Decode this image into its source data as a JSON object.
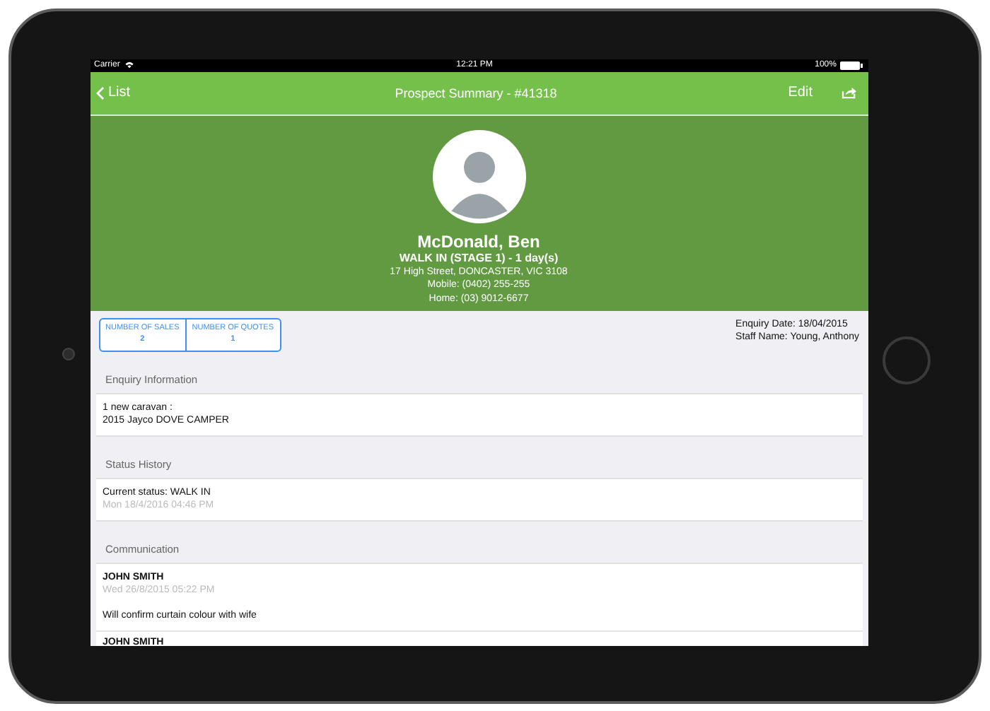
{
  "status_bar": {
    "carrier": "Carrier",
    "time": "12:21 PM",
    "battery": "100%"
  },
  "nav": {
    "back": "List",
    "title": "Prospect Summary - #41318",
    "edit": "Edit"
  },
  "profile": {
    "name": "McDonald, Ben",
    "stage": "WALK IN (STAGE 1) - 1 day(s)",
    "address": "17 High Street, DONCASTER, VIC 3108",
    "mobile": "Mobile: (0402) 255-255",
    "home": "Home: (03) 9012-6677"
  },
  "stats": [
    {
      "label": "NUMBER OF SALES",
      "value": "2"
    },
    {
      "label": "NUMBER OF QUOTES",
      "value": "1"
    }
  ],
  "enquiry_date": "Enquiry Date: 18/04/2015",
  "staff_name": "Staff Name: Young, Anthony",
  "sections": [
    {
      "title": "Enquiry Information",
      "items": [
        {
          "lines": [
            "1 new caravan :",
            "2015 Jayco DOVE CAMPER"
          ]
        }
      ]
    },
    {
      "title": "Status History",
      "items": [
        {
          "lines": [
            "Current status: WALK IN"
          ],
          "time": "Mon 18/4/2016 04:46 PM"
        }
      ]
    },
    {
      "title": "Communication",
      "items": [
        {
          "heading": "JOHN SMITH",
          "time": "Wed 26/8/2015 05:22 PM",
          "note": "Will confirm curtain colour with wife"
        },
        {
          "heading": "JOHN SMITH"
        }
      ]
    }
  ]
}
